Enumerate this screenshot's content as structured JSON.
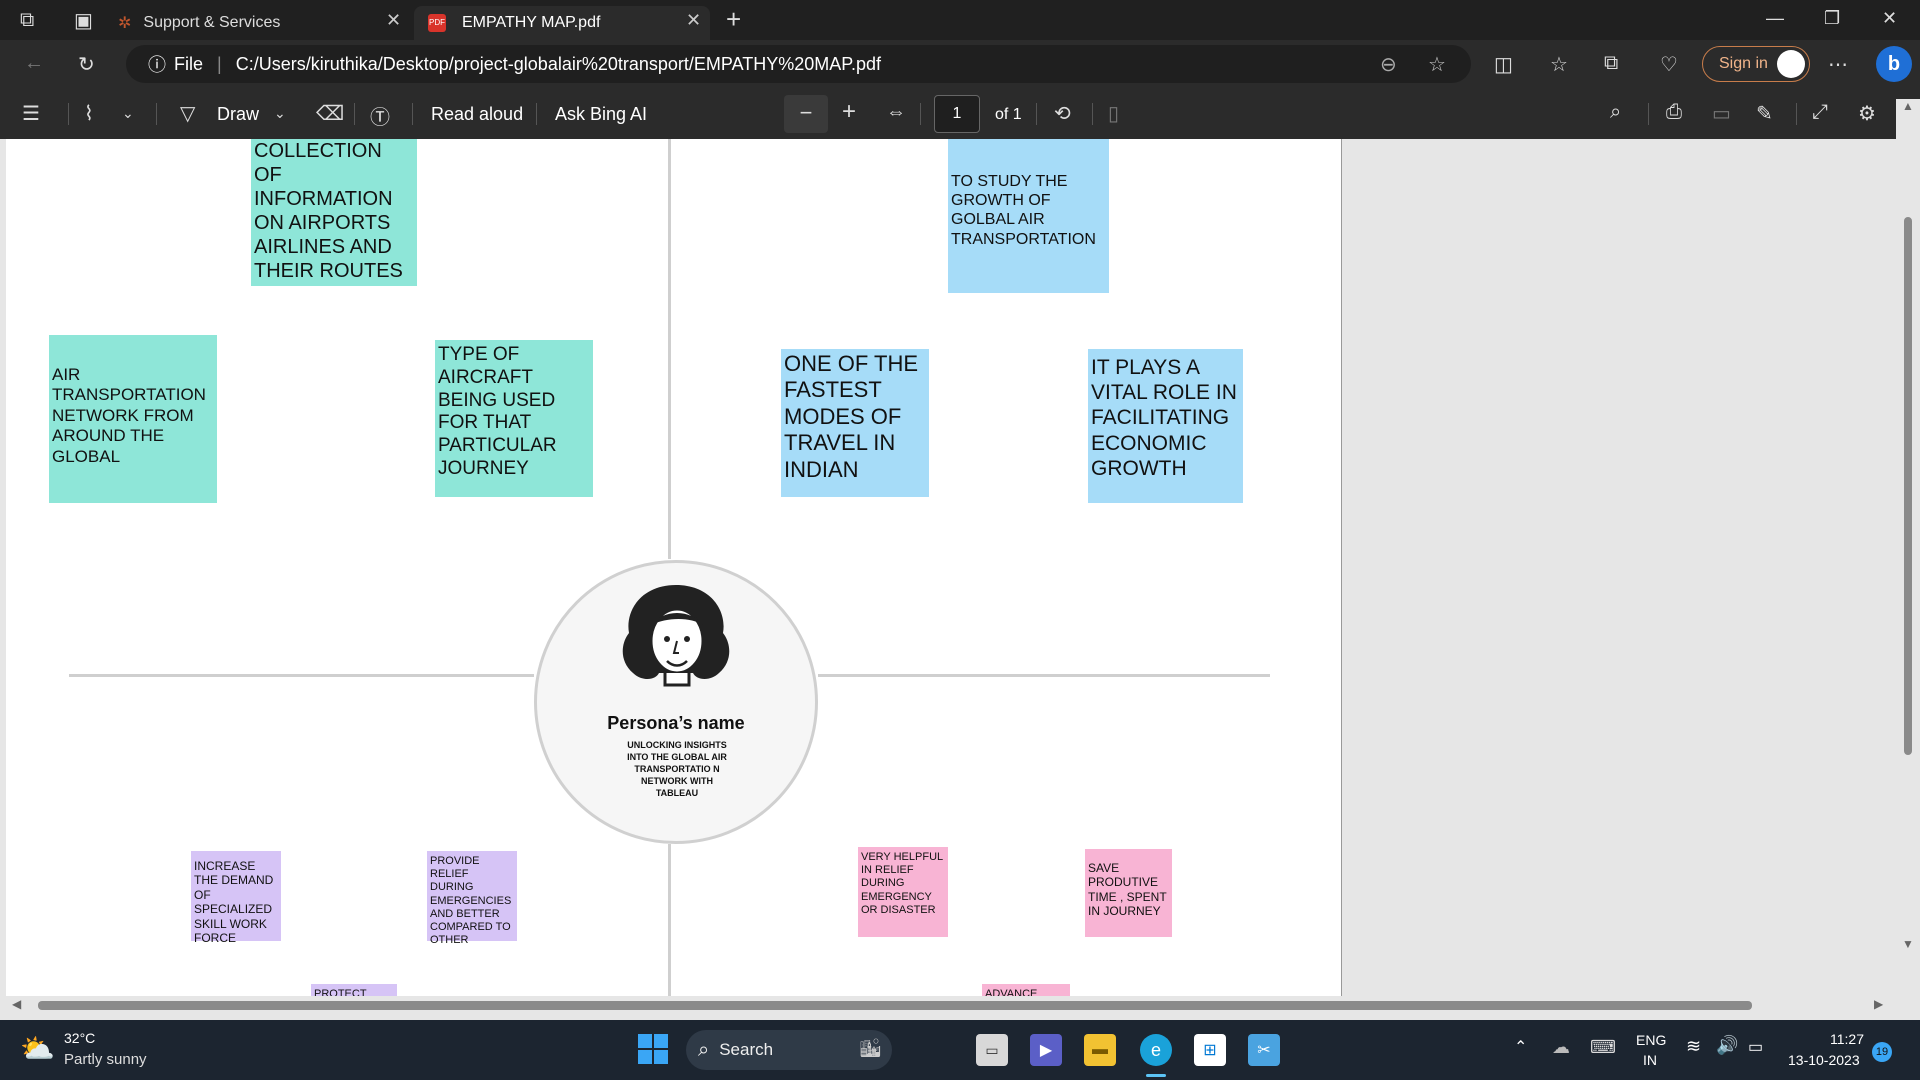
{
  "tabs": [
    {
      "label": "Support & Services",
      "close": "✕"
    },
    {
      "label": "EMPATHY MAP.pdf",
      "close": "✕"
    }
  ],
  "new_tab": "+",
  "window": {
    "minimize": "—",
    "restore": "❐",
    "close": "✕"
  },
  "address": {
    "file_label": "File",
    "url": "C:/Users/kiruthika/Desktop/project-globalair%20transport/EMPATHY%20MAP.pdf",
    "sign_in": "Sign in"
  },
  "pdf_toolbar": {
    "draw": "Draw",
    "read_aloud": "Read aloud",
    "ask_bing": "Ask Bing AI",
    "page_number": "1",
    "page_total": "of 1"
  },
  "notes": {
    "n1": "COLLECTION OF INFORMATION ON AIRPORTS AIRLINES AND THEIR ROUTES",
    "n2": "AIR TRANSPORTATION NETWORK FROM AROUND THE GLOBAL",
    "n3": "TYPE OF AIRCRAFT BEING USED FOR THAT PARTICULAR JOURNEY",
    "n4": "TO STUDY THE GROWTH OF GOLBAL AIR TRANSPORTATION",
    "n5": "ONE OF THE FASTEST MODES OF TRAVEL IN INDIAN",
    "n6": "IT PLAYS A VITAL ROLE IN FACILITATING ECONOMIC GROWTH",
    "n7": "INCREASE THE DEMAND OF SPECIALIZED SKILL WORK FORCE",
    "n8": "PROVIDE RELIEF DURING EMERGENCIES AND BETTER COMPARED TO OTHER",
    "n9": "VERY HELPFUL IN RELIEF DURING EMERGENCY OR DISASTER",
    "n10": "SAVE PRODUTIVE TIME , SPENT IN JOURNEY",
    "n11": "PROTECT",
    "n12": "ADVANCE"
  },
  "persona": {
    "name": "Persona’s name",
    "desc": "UNLOCKING INSIGHTS INTO THE GLOBAL AIR TRANSPORTATIO N NETWORK WITH TABLEAU"
  },
  "taskbar": {
    "weather_temp": "32°C",
    "weather_desc": "Partly sunny",
    "search": "Search",
    "lang1": "ENG",
    "lang2": "IN",
    "time": "11:27",
    "date": "13-10-2023",
    "notif_count": "19"
  },
  "colors": {
    "teal": "#8ee6d8",
    "blue": "#a6dcf8",
    "purple": "#d6c4f6",
    "pink": "#f8b4d4"
  }
}
